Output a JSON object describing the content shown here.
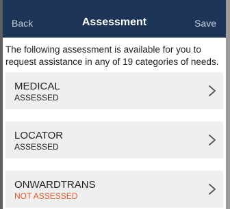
{
  "nav": {
    "back_label": "Back",
    "title": "Assessment",
    "save_label": "Save"
  },
  "intro": {
    "text": "The following assessment is available for you to request assistance in any of 19 categories of needs."
  },
  "categories": [
    {
      "name": "MEDICAL",
      "status": "ASSESSED",
      "status_color": "#1e1e1e"
    },
    {
      "name": "LOCATOR",
      "status": "ASSESSED",
      "status_color": "#1e1e1e"
    },
    {
      "name": "ONWARDTRANS",
      "status": "NOT ASSESSED",
      "status_color": "#e25a2b"
    }
  ],
  "colors": {
    "navbar_bg": "#1c3557",
    "card_bg": "#efefef",
    "not_assessed": "#e25a2b"
  },
  "icons": {
    "row_arrow": "chevron-right-icon"
  }
}
